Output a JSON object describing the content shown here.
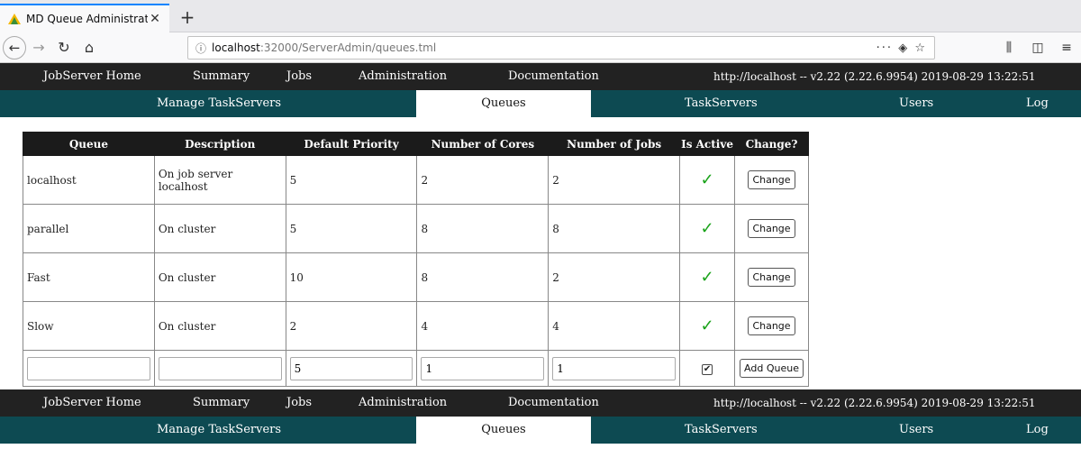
{
  "browser": {
    "tab_title": "MD Queue Administration",
    "url_host": "localhost",
    "url_path": ":32000/ServerAdmin/queues.tml"
  },
  "main_nav": {
    "home": "JobServer Home",
    "summary": "Summary",
    "jobs": "Jobs",
    "administration": "Administration",
    "documentation": "Documentation",
    "server_info": "http://localhost -- v2.22 (2.22.6.9954) 2019-08-29 13:22:51"
  },
  "sub_nav": {
    "manage_taskservers": "Manage TaskServers",
    "queues": "Queues",
    "taskservers": "TaskServers",
    "users": "Users",
    "log": "Log"
  },
  "table": {
    "headers": [
      "Queue",
      "Description",
      "Default Priority",
      "Number of Cores",
      "Number of Jobs",
      "Is Active",
      "Change?"
    ],
    "rows": [
      {
        "queue": "localhost",
        "description": "On job server localhost",
        "priority": "5",
        "cores": "2",
        "jobs": "2",
        "active": "✓",
        "change": "Change"
      },
      {
        "queue": "parallel",
        "description": "On cluster",
        "priority": "5",
        "cores": "8",
        "jobs": "8",
        "active": "✓",
        "change": "Change"
      },
      {
        "queue": "Fast",
        "description": "On cluster",
        "priority": "10",
        "cores": "8",
        "jobs": "2",
        "active": "✓",
        "change": "Change"
      },
      {
        "queue": "Slow",
        "description": "On cluster",
        "priority": "2",
        "cores": "4",
        "jobs": "4",
        "active": "✓",
        "change": "Change"
      }
    ],
    "new_row": {
      "queue": "",
      "description": "",
      "priority": "5",
      "cores": "1",
      "jobs": "1",
      "active_checked": "✔",
      "add_label": "Add Queue"
    }
  },
  "colors": {
    "main_nav_bg": "#222222",
    "sub_nav_bg": "#0d4a52",
    "active_check": "#1aa31a"
  }
}
